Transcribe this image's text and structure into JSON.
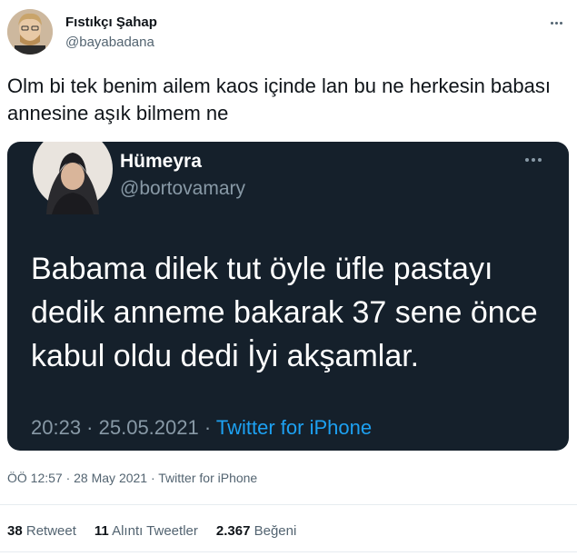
{
  "author": {
    "name": "Fıstıkçı Şahap",
    "handle": "@bayabadana"
  },
  "tweet": {
    "text": "Olm bi tek benim ailem kaos içinde lan bu ne herkesin babası annesine aşık bilmem ne"
  },
  "embedded": {
    "name": "Hümeyra",
    "handle": "@bortovamary",
    "text": "Babama dilek tut öyle üfle pastayı dedik anneme bakarak 37 sene önce kabul oldu dedi İyi akşamlar.",
    "time": "20:23",
    "date": "25.05.2021",
    "separator": " · ",
    "source": "Twitter for iPhone"
  },
  "meta": {
    "line": "ÖÖ 12:57 · 28 May 2021 · Twitter for iPhone"
  },
  "stats": {
    "retweets_count": "38",
    "retweets_label": "Retweet",
    "quotes_count": "11",
    "quotes_label": "Alıntı Tweetler",
    "likes_count": "2.367",
    "likes_label": "Beğeni"
  },
  "icons": {
    "more": "more-horizontal-icon"
  },
  "colors": {
    "embed_bg": "#15202b",
    "link": "#1da1f2",
    "secondary": "#536471"
  }
}
